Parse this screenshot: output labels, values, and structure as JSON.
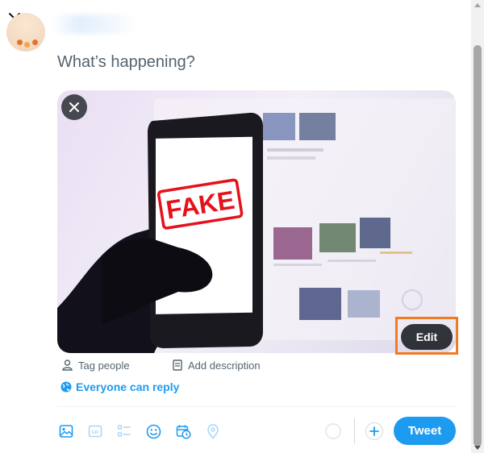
{
  "compose": {
    "placeholder": "What’s happening?",
    "media": {
      "stamp_text": "FAKE",
      "edit_label": "Edit"
    },
    "tag_people_label": "Tag people",
    "add_description_label": "Add description",
    "reply_setting_label": "Everyone can reply"
  },
  "toolbar": {
    "icons": [
      "image-icon",
      "gif-icon",
      "poll-icon",
      "emoji-icon",
      "schedule-icon",
      "location-icon"
    ],
    "gif_label": "GIF",
    "tweet_label": "Tweet"
  },
  "colors": {
    "accent": "#1d9bf0",
    "text_secondary": "#536471",
    "highlight": "#f07b22",
    "stamp_red": "#e4121b"
  }
}
